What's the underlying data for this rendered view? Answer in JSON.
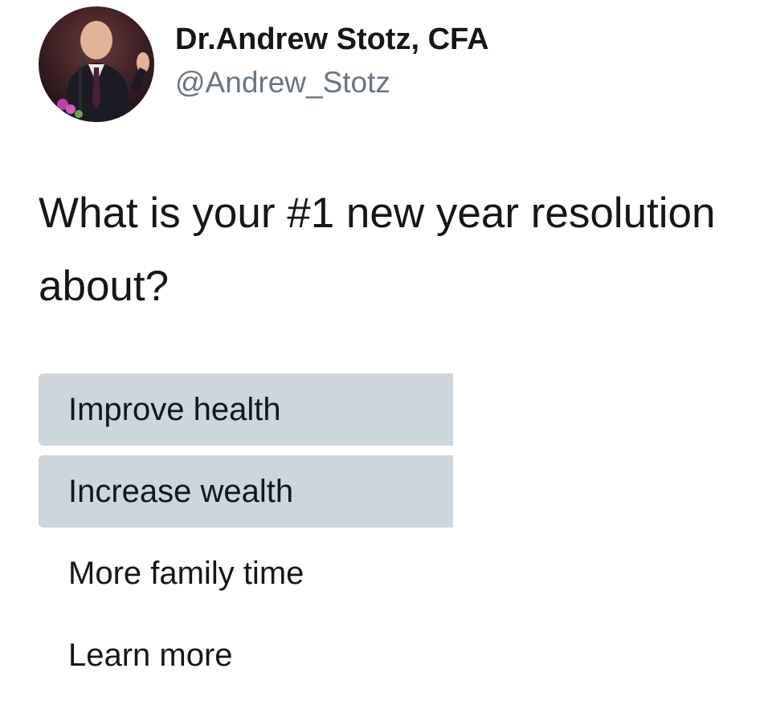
{
  "author": {
    "display_name": "Dr.Andrew Stotz, CFA",
    "handle": "@Andrew_Stotz",
    "avatar_icon": "profile-photo-speaker-at-microphone"
  },
  "tweet": {
    "text_line_1": "What is your #1 new year resolution",
    "text_line_2": "about?"
  },
  "poll": {
    "fill_color": "#ccd6dd",
    "options": [
      {
        "label": "Improve health",
        "fill": 0.6
      },
      {
        "label": "Increase wealth",
        "fill": 0.6
      },
      {
        "label": "More family time",
        "fill": 0
      },
      {
        "label": "Learn more",
        "fill": 0
      }
    ]
  }
}
